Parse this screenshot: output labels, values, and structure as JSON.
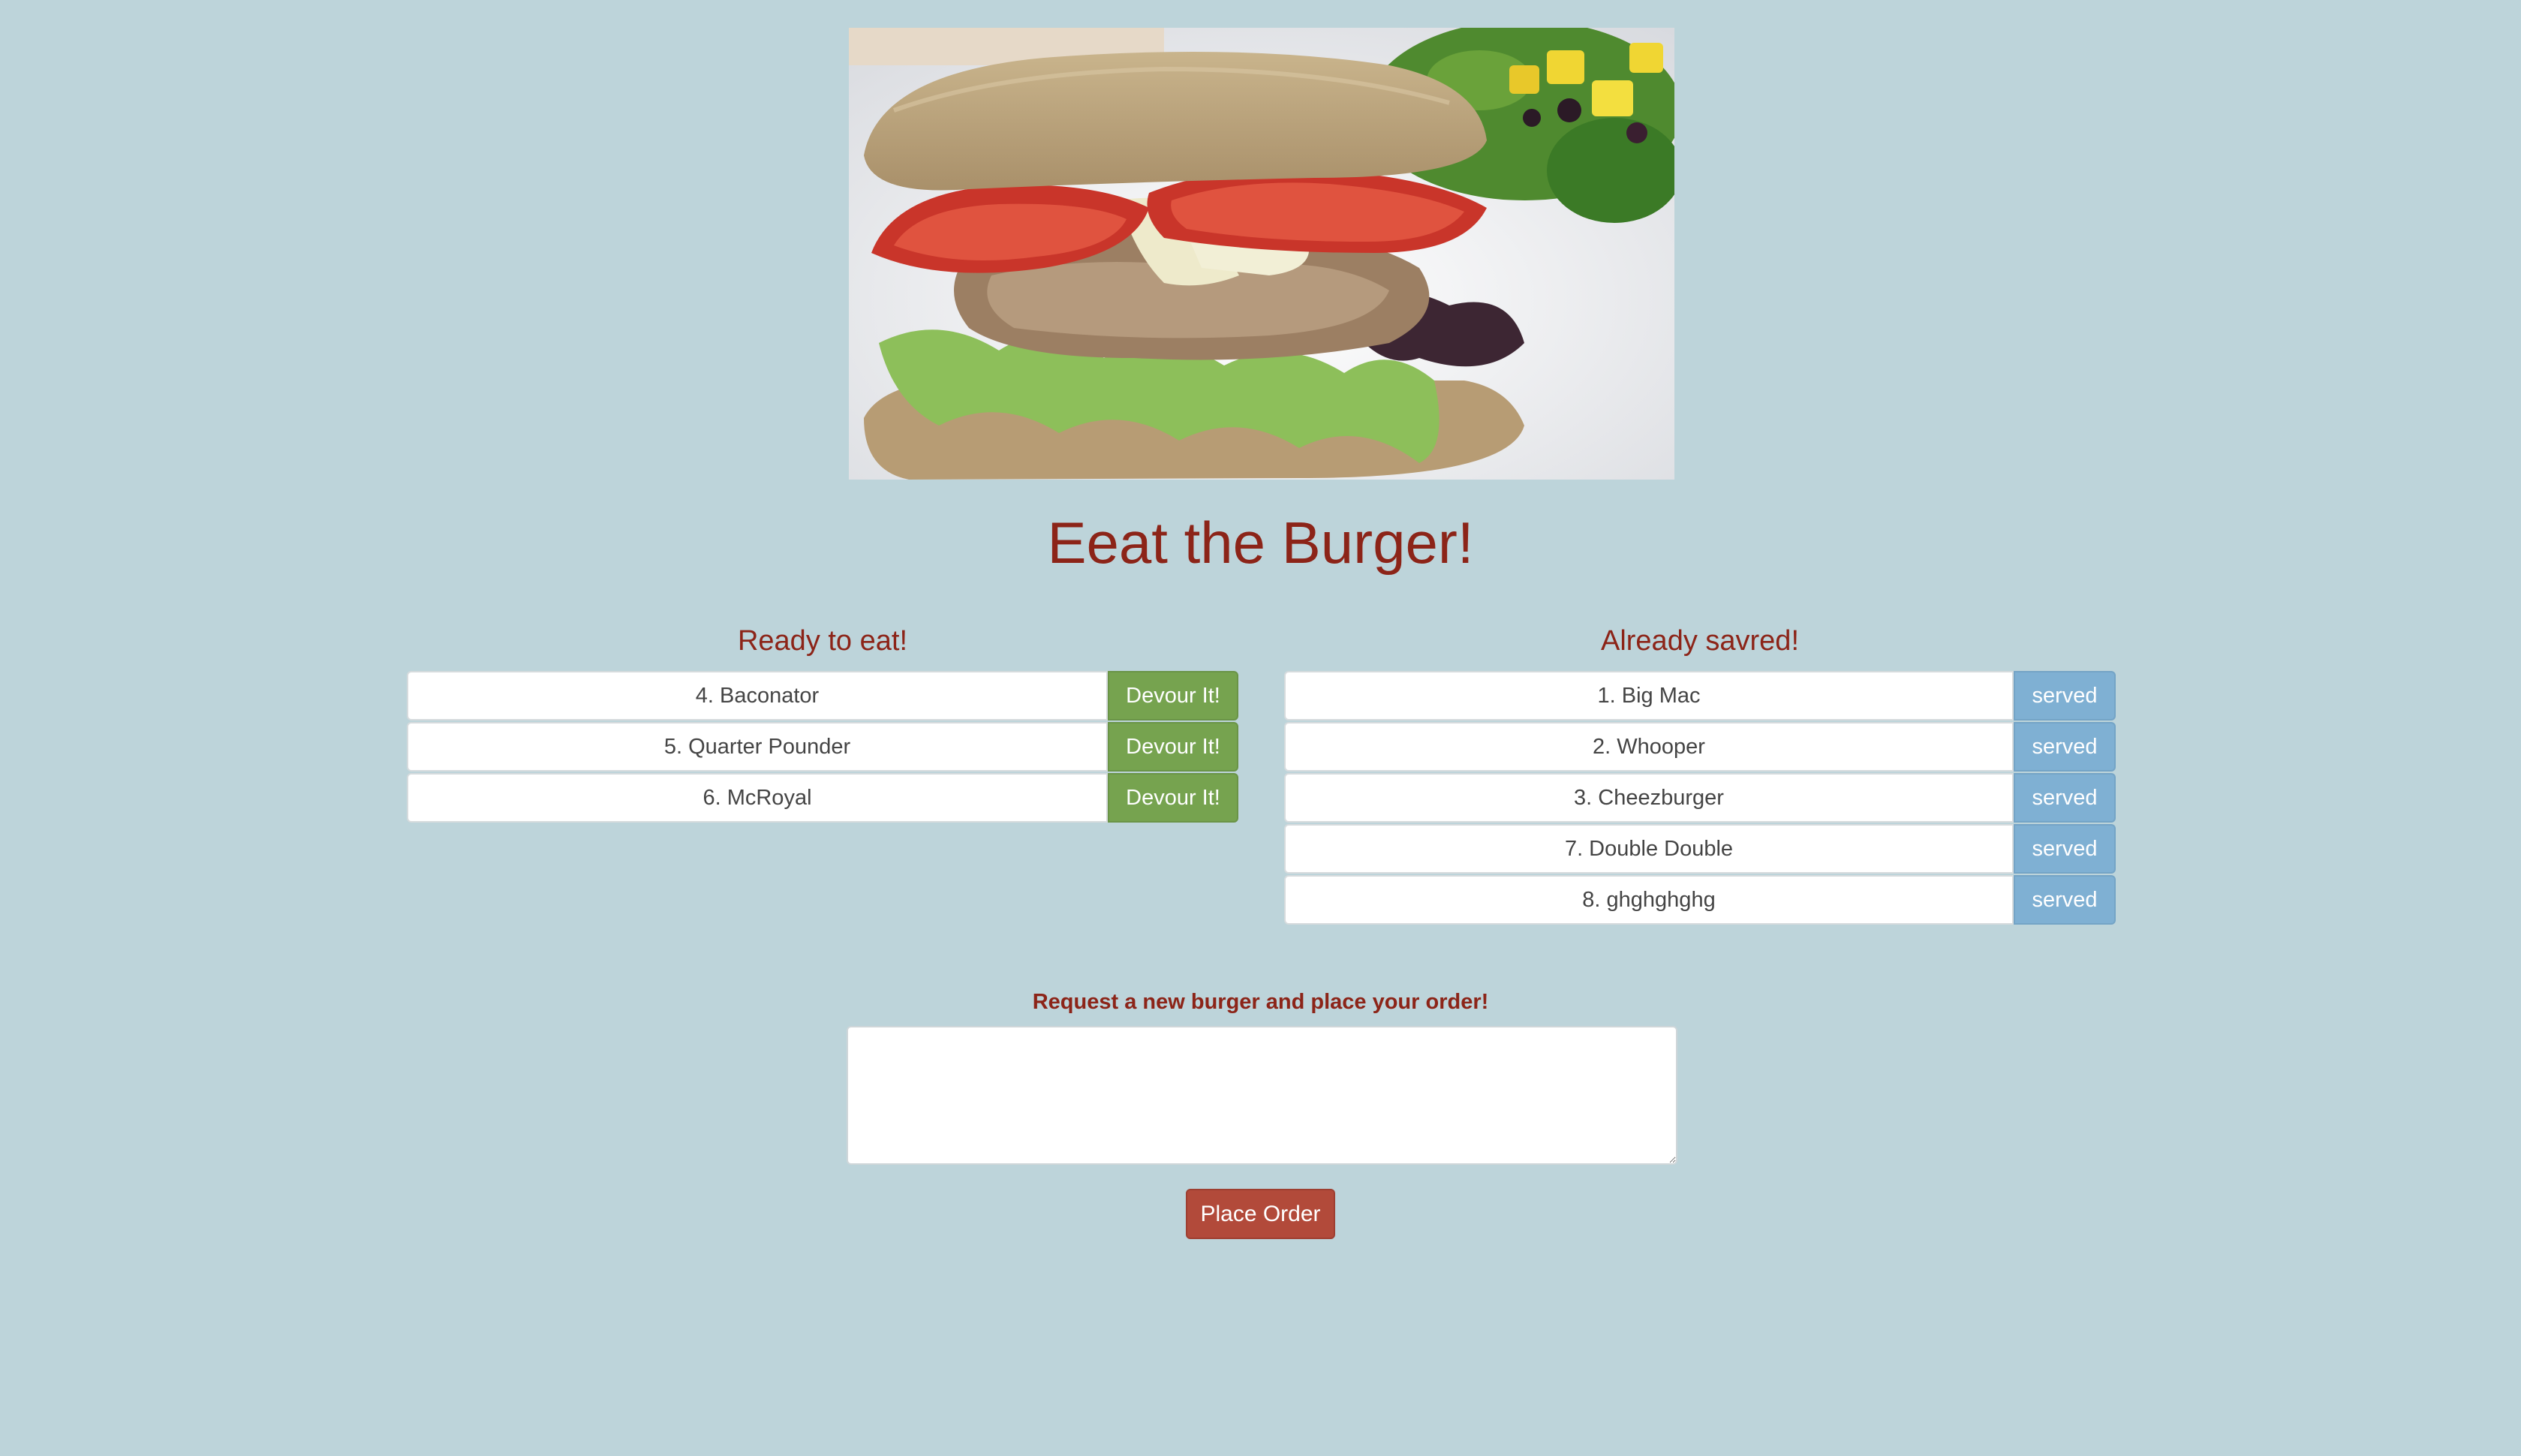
{
  "page": {
    "title": "Eeat the Burger!"
  },
  "ready": {
    "heading": "Ready to eat!",
    "action_label": "Devour It!",
    "items": [
      {
        "label": "4. Baconator"
      },
      {
        "label": "5. Quarter Pounder"
      },
      {
        "label": "6. McRoyal"
      }
    ]
  },
  "served": {
    "heading": "Already savred!",
    "status_label": "served",
    "items": [
      {
        "label": "1. Big Mac"
      },
      {
        "label": "2. Whooper"
      },
      {
        "label": "3. Cheezburger"
      },
      {
        "label": "7. Double Double"
      },
      {
        "label": "8. ghghghghg"
      }
    ]
  },
  "order": {
    "prompt": "Request a new burger and place your order!",
    "input_value": "",
    "button_label": "Place Order"
  },
  "colors": {
    "background": "#bdd4da",
    "accent": "#8c2418",
    "devour_button": "#76a34f",
    "served_button": "#7fb0d3",
    "order_button": "#b24a3a"
  },
  "icons": {
    "hero": "burger-photo"
  }
}
